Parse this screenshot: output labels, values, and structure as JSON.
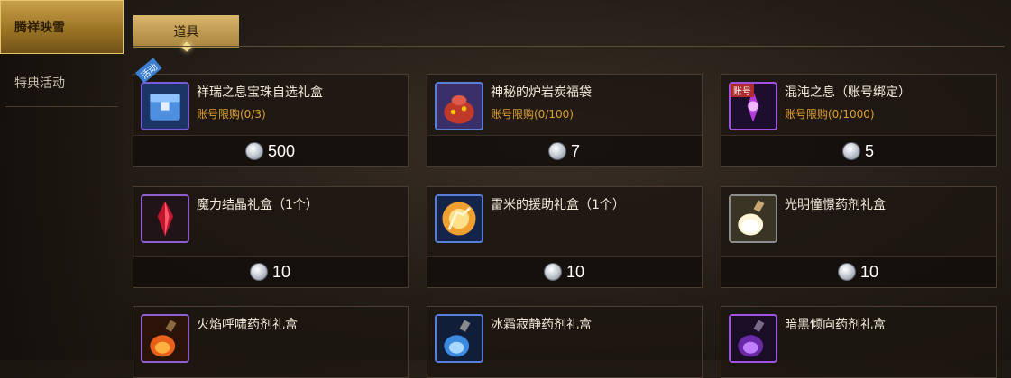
{
  "sidebar": {
    "active_label": "腾祥映雪",
    "items": [
      {
        "label": "特典活动"
      }
    ]
  },
  "tabs": [
    {
      "label": "道具"
    }
  ],
  "currency_icon": "silver-coin-icon",
  "items": [
    {
      "name": "祥瑞之息宝珠自选礼盒",
      "limit": "账号限购(0/3)",
      "price": "500",
      "icon": "blue-chest-icon",
      "badge": "活动"
    },
    {
      "name": "神秘的炉岩炭福袋",
      "limit": "账号限购(0/100)",
      "price": "7",
      "icon": "lucky-bag-icon"
    },
    {
      "name": "混沌之息（账号绑定）",
      "limit": "账号限购(0/1000)",
      "price": "5",
      "icon": "chaos-breath-icon",
      "badge": "账号"
    },
    {
      "name": "魔力结晶礼盒（1个）",
      "limit": "",
      "price": "10",
      "icon": "red-crystal-icon"
    },
    {
      "name": "雷米的援助礼盒（1个）",
      "limit": "",
      "price": "10",
      "icon": "glowing-hand-icon"
    },
    {
      "name": "光明憧憬药剂礼盒",
      "limit": "",
      "price": "10",
      "icon": "light-potion-icon"
    },
    {
      "name": "火焰呼啸药剂礼盒",
      "limit": "",
      "price": "",
      "icon": "fire-potion-icon"
    },
    {
      "name": "冰霜寂静药剂礼盒",
      "limit": "",
      "price": "",
      "icon": "frost-potion-icon"
    },
    {
      "name": "暗黑倾向药剂礼盒",
      "limit": "",
      "price": "",
      "icon": "dark-potion-icon"
    }
  ]
}
